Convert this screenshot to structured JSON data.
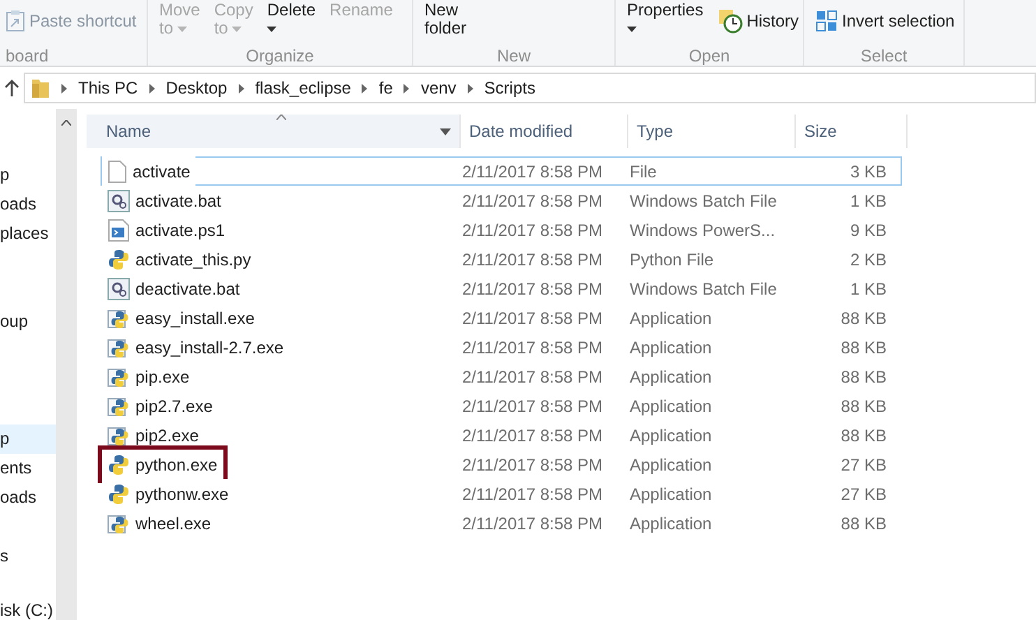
{
  "ribbon": {
    "groups": [
      {
        "label": "board",
        "items": [
          {
            "kind": "paste",
            "label": "Paste shortcut",
            "disabled": true
          }
        ]
      },
      {
        "label": "Organize",
        "items": [
          {
            "kind": "large",
            "label": "Move",
            "sub": "to",
            "caret": true,
            "disabled": true
          },
          {
            "kind": "large",
            "label": "Copy",
            "sub": "to",
            "caret": true,
            "disabled": true
          },
          {
            "kind": "large",
            "label": "Delete",
            "caret": true,
            "disabled": false
          },
          {
            "kind": "large",
            "label": "Rename",
            "disabled": true
          }
        ]
      },
      {
        "label": "New",
        "items": [
          {
            "kind": "large",
            "label": "New",
            "sub": "folder",
            "disabled": false
          }
        ]
      },
      {
        "label": "Open",
        "items": [
          {
            "kind": "large",
            "label": "Properties",
            "caret": true,
            "disabled": false
          },
          {
            "kind": "history",
            "label": "History",
            "disabled": false
          }
        ]
      },
      {
        "label": "Select",
        "items": [
          {
            "kind": "invert",
            "label": "Invert selection",
            "disabled": false
          }
        ]
      }
    ]
  },
  "address": {
    "crumbs": [
      "This PC",
      "Desktop",
      "flask_eclipse",
      "fe",
      "venv",
      "Scripts"
    ]
  },
  "nav": {
    "groups": [
      [
        {
          "label": "p",
          "selected": false
        },
        {
          "label": "oads",
          "selected": false
        },
        {
          "label": "places",
          "selected": false
        }
      ],
      [
        {
          "label": "oup",
          "selected": false
        }
      ],
      [
        {
          "label": "p",
          "selected": true
        },
        {
          "label": "ents",
          "selected": false
        },
        {
          "label": "oads",
          "selected": false
        }
      ],
      [
        {
          "label": "s",
          "selected": false
        }
      ],
      [
        {
          "label": "isk (C:)",
          "selected": false
        }
      ]
    ]
  },
  "table": {
    "columns": [
      "Name",
      "Date modified",
      "Type",
      "Size"
    ],
    "rows": [
      {
        "kind": "file",
        "name": "activate",
        "date": "2/11/2017 8:58 PM",
        "type": "File",
        "size": "3 KB",
        "focused": true,
        "highlighted": false
      },
      {
        "kind": "batch",
        "name": "activate.bat",
        "date": "2/11/2017 8:58 PM",
        "type": "Windows Batch File",
        "size": "1 KB",
        "focused": false,
        "highlighted": false
      },
      {
        "kind": "powershell",
        "name": "activate.ps1",
        "date": "2/11/2017 8:58 PM",
        "type": "Windows PowerS...",
        "size": "9 KB",
        "focused": false,
        "highlighted": false
      },
      {
        "kind": "python",
        "name": "activate_this.py",
        "date": "2/11/2017 8:58 PM",
        "type": "Python File",
        "size": "2 KB",
        "focused": false,
        "highlighted": false
      },
      {
        "kind": "batch",
        "name": "deactivate.bat",
        "date": "2/11/2017 8:58 PM",
        "type": "Windows Batch File",
        "size": "1 KB",
        "focused": false,
        "highlighted": false
      },
      {
        "kind": "exe",
        "name": "easy_install.exe",
        "date": "2/11/2017 8:58 PM",
        "type": "Application",
        "size": "88 KB",
        "focused": false,
        "highlighted": false
      },
      {
        "kind": "exe",
        "name": "easy_install-2.7.exe",
        "date": "2/11/2017 8:58 PM",
        "type": "Application",
        "size": "88 KB",
        "focused": false,
        "highlighted": false
      },
      {
        "kind": "exe",
        "name": "pip.exe",
        "date": "2/11/2017 8:58 PM",
        "type": "Application",
        "size": "88 KB",
        "focused": false,
        "highlighted": false
      },
      {
        "kind": "exe",
        "name": "pip2.7.exe",
        "date": "2/11/2017 8:58 PM",
        "type": "Application",
        "size": "88 KB",
        "focused": false,
        "highlighted": false
      },
      {
        "kind": "exe",
        "name": "pip2.exe",
        "date": "2/11/2017 8:58 PM",
        "type": "Application",
        "size": "88 KB",
        "focused": false,
        "highlighted": false
      },
      {
        "kind": "python",
        "name": "python.exe",
        "date": "2/11/2017 8:58 PM",
        "type": "Application",
        "size": "27 KB",
        "focused": false,
        "highlighted": true
      },
      {
        "kind": "python",
        "name": "pythonw.exe",
        "date": "2/11/2017 8:58 PM",
        "type": "Application",
        "size": "27 KB",
        "focused": false,
        "highlighted": false
      },
      {
        "kind": "exe",
        "name": "wheel.exe",
        "date": "2/11/2017 8:58 PM",
        "type": "Application",
        "size": "88 KB",
        "focused": false,
        "highlighted": false
      }
    ]
  }
}
